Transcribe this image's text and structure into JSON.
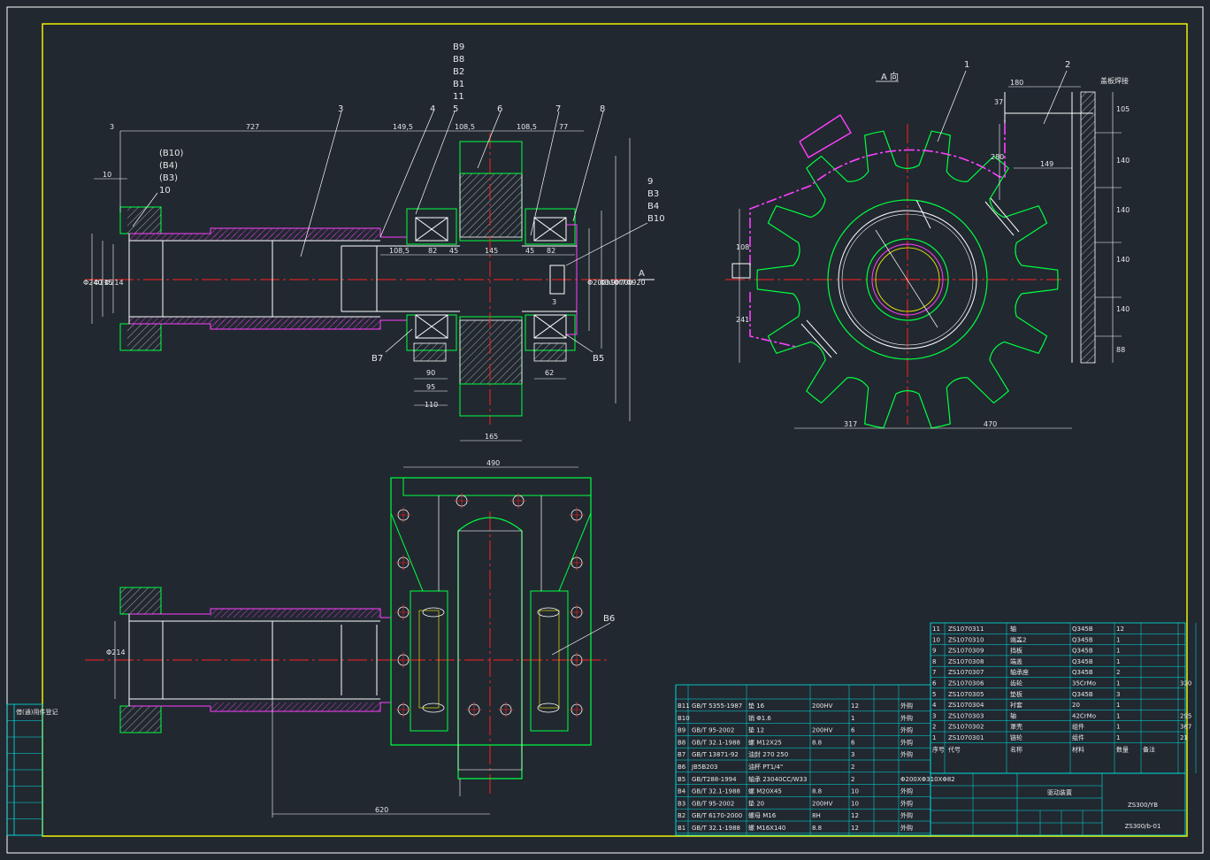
{
  "drawing": {
    "view_label": "A 向",
    "section_mark": "A",
    "cover_label": "盖板焊接"
  },
  "part_numbers": [
    "1",
    "2",
    "3",
    "4",
    "5",
    "6",
    "7",
    "8"
  ],
  "callouts": {
    "top_stack": [
      "B9",
      "B8",
      "B2",
      "B1",
      "11",
      "5"
    ],
    "left_stack": [
      "(B10)",
      "(B4)",
      "(B3)",
      "10"
    ],
    "right_stack": [
      "9",
      "B3",
      "B4",
      "B10"
    ],
    "b7": "B7",
    "b5": "B5",
    "b6": "B6"
  },
  "dimensions": {
    "d3": "3",
    "d727": "727",
    "d149_5": "149,5",
    "d108_5a": "108,5",
    "d77": "77",
    "d10": "10",
    "d108_5b": "108,5",
    "d82a": "82",
    "d45a": "45",
    "d145": "145",
    "d45b": "45",
    "d82b": "82",
    "d3b": "3",
    "d240": "Φ240",
    "d215": "Φ215",
    "d214": "Φ214",
    "d200": "Φ200h9",
    "d310": "Φ310f7",
    "d700": "Φ700",
    "d920": "Φ920",
    "d90": "90",
    "d95": "95",
    "d110": "110",
    "d165": "165",
    "d62": "62",
    "d180": "180",
    "d37": "37",
    "d280": "280",
    "d149": "149",
    "d105": "105",
    "d140a": "140",
    "d140b": "140",
    "d140c": "140",
    "d140d": "140",
    "d88": "88",
    "d108": "108",
    "d241": "241",
    "d317": "317",
    "d470": "470",
    "d490": "490",
    "d620": "620",
    "d214b": "Φ214",
    "d165b": "165"
  },
  "parts_table": [
    {
      "no": "11",
      "code": "ZS1070311",
      "name": "轴",
      "mat": "Q345B",
      "qty": "12",
      "wt": ""
    },
    {
      "no": "10",
      "code": "ZS1070310",
      "name": "端盖2",
      "mat": "Q345B",
      "qty": "1",
      "wt": ""
    },
    {
      "no": "9",
      "code": "ZS1070309",
      "name": "挡板",
      "mat": "Q345B",
      "qty": "1",
      "wt": ""
    },
    {
      "no": "8",
      "code": "ZS1070308",
      "name": "端盖",
      "mat": "Q345B",
      "qty": "1",
      "wt": ""
    },
    {
      "no": "7",
      "code": "ZS1070307",
      "name": "轴承座",
      "mat": "Q345B",
      "qty": "2",
      "wt": ""
    },
    {
      "no": "6",
      "code": "ZS1070306",
      "name": "齿轮",
      "mat": "35CrMo",
      "qty": "1",
      "wt": "320"
    },
    {
      "no": "5",
      "code": "ZS1070305",
      "name": "垫板",
      "mat": "Q345B",
      "qty": "3",
      "wt": ""
    },
    {
      "no": "4",
      "code": "ZS1070304",
      "name": "衬套",
      "mat": "20",
      "qty": "1",
      "wt": ""
    },
    {
      "no": "3",
      "code": "ZS1070303",
      "name": "轴",
      "mat": "42CrMo",
      "qty": "1",
      "wt": "295"
    },
    {
      "no": "2",
      "code": "ZS1070302",
      "name": "罩壳",
      "mat": "组件",
      "qty": "1",
      "wt": "367"
    },
    {
      "no": "1",
      "code": "ZS1070301",
      "name": "链轮",
      "mat": "组件",
      "qty": "1",
      "wt": "21"
    }
  ],
  "parts_header": [
    "序号",
    "代号",
    "名称",
    "材料",
    "数量",
    "备注"
  ],
  "std_table": [
    {
      "no": "B11",
      "code": "GB/T 5355-1987",
      "name": "垫 16",
      "spec": "200HV",
      "qty": "12",
      "note": "外购"
    },
    {
      "no": "B10",
      "code": "",
      "name": "销 Φ1.6",
      "spec": "",
      "qty": "1",
      "note": "外购"
    },
    {
      "no": "B9",
      "code": "GB/T 95-2002",
      "name": "垫 12",
      "spec": "200HV",
      "qty": "6",
      "note": "外购"
    },
    {
      "no": "B8",
      "code": "GB/T 32.1-1988",
      "name": "螺 M12X25",
      "spec": "8.8",
      "qty": "6",
      "note": "外购"
    },
    {
      "no": "B7",
      "code": "GB/T 13871-92",
      "name": "油封 270 250",
      "spec": "",
      "qty": "3",
      "note": "外购"
    },
    {
      "no": "B6",
      "code": "JB5B203",
      "name": "油杯 PT1/4\"",
      "spec": "",
      "qty": "2",
      "note": ""
    },
    {
      "no": "B5",
      "code": "GB/T288-1994",
      "name": "轴承 23040CC/W33",
      "spec": "",
      "qty": "2",
      "note": "Φ200XΦ310XΦ82"
    },
    {
      "no": "B4",
      "code": "GB/T 32.1-1988",
      "name": "螺 M20X45",
      "spec": "8.8",
      "qty": "10",
      "note": "外购"
    },
    {
      "no": "B3",
      "code": "GB/T 95-2002",
      "name": "垫 20",
      "spec": "200HV",
      "qty": "10",
      "note": "外购"
    },
    {
      "no": "B2",
      "code": "GB/T 6170-2000",
      "name": "螺母 M16",
      "spec": "8H",
      "qty": "12",
      "note": "外购"
    },
    {
      "no": "B1",
      "code": "GB/T 32.1-1988",
      "name": "螺 M16X140",
      "spec": "8.8",
      "qty": "12",
      "note": "外购"
    }
  ],
  "title_block": {
    "title": "驱动装置",
    "code1": "ZS300/YB",
    "code2": "ZS300/b-01"
  },
  "side_table": [
    "借(通)用件登记",
    "",
    "",
    "",
    "",
    "",
    "",
    ""
  ]
}
